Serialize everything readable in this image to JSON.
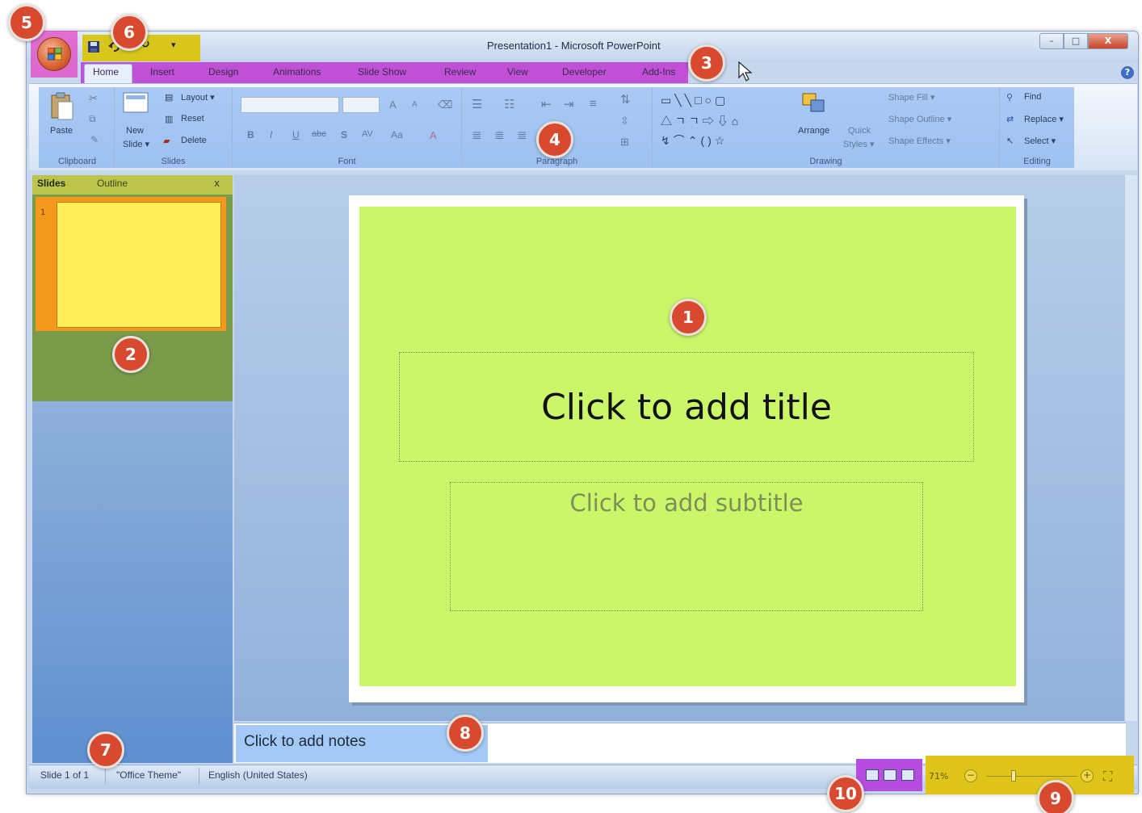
{
  "window": {
    "title": "Presentation1 - Microsoft PowerPoint",
    "controls": {
      "minimize": "–",
      "maximize": "□",
      "close": "X"
    }
  },
  "quick_access": {
    "save_icon": "save-icon",
    "undo_icon": "undo-icon",
    "redo_glyph": "↻",
    "customize_glyph": "▾"
  },
  "tabs": [
    "Home",
    "Insert",
    "Design",
    "Animations",
    "Slide Show",
    "Review",
    "View",
    "Developer",
    "Add-Ins"
  ],
  "ribbon": {
    "clipboard": {
      "label": "Clipboard",
      "paste": "Paste"
    },
    "slides": {
      "label": "Slides",
      "new_slide": "New",
      "new_slide_2": "Slide ▾",
      "layout": "Layout ▾",
      "reset": "Reset",
      "delete": "Delete"
    },
    "font": {
      "label": "Font",
      "bold": "B",
      "italic": "I",
      "underline": "U",
      "strike": "abc",
      "shadow": "S",
      "spacing": "AV",
      "case": "Aa",
      "grow": "A",
      "shrink": "A"
    },
    "paragraph": {
      "label": "Paragraph"
    },
    "drawing": {
      "label": "Drawing",
      "arrange": "Arrange",
      "quick_styles": "Quick",
      "quick_styles_2": "Styles ▾",
      "shape_fill": "Shape Fill ▾",
      "shape_outline": "Shape Outline ▾",
      "shape_effects": "Shape Effects ▾"
    },
    "editing": {
      "label": "Editing",
      "find": "Find",
      "replace": "Replace ▾",
      "select": "Select ▾"
    }
  },
  "left_pane": {
    "tab_slides": "Slides",
    "tab_outline": "Outline",
    "close": "x",
    "thumb_number": "1"
  },
  "slide": {
    "title_placeholder": "Click to add title",
    "subtitle_placeholder": "Click to add subtitle"
  },
  "notes": {
    "placeholder": "Click to add notes"
  },
  "status": {
    "slide_info": "Slide 1 of 1",
    "theme": "\"Office Theme\"",
    "language": "English (United States)",
    "zoom": "71%",
    "zoom_minus": "−",
    "zoom_plus": "+"
  },
  "callouts": [
    "1",
    "2",
    "3",
    "4",
    "5",
    "6",
    "7",
    "8",
    "9",
    "10"
  ],
  "colors": {
    "slide_area": "#ccf66a",
    "thumbnail": "#ffee5a",
    "thumb_selection": "#f39a1c",
    "tabs_highlight": "#c050d6",
    "ribbon_highlight": "#6fa4ec",
    "qat_highlight": "#d9c61b",
    "office_button_highlight": "#e14fc6",
    "notes_highlight": "#a5c9f6",
    "zoom_highlight": "#dfc51a",
    "views_highlight": "#b64ce0",
    "callout": "#d9492f"
  }
}
